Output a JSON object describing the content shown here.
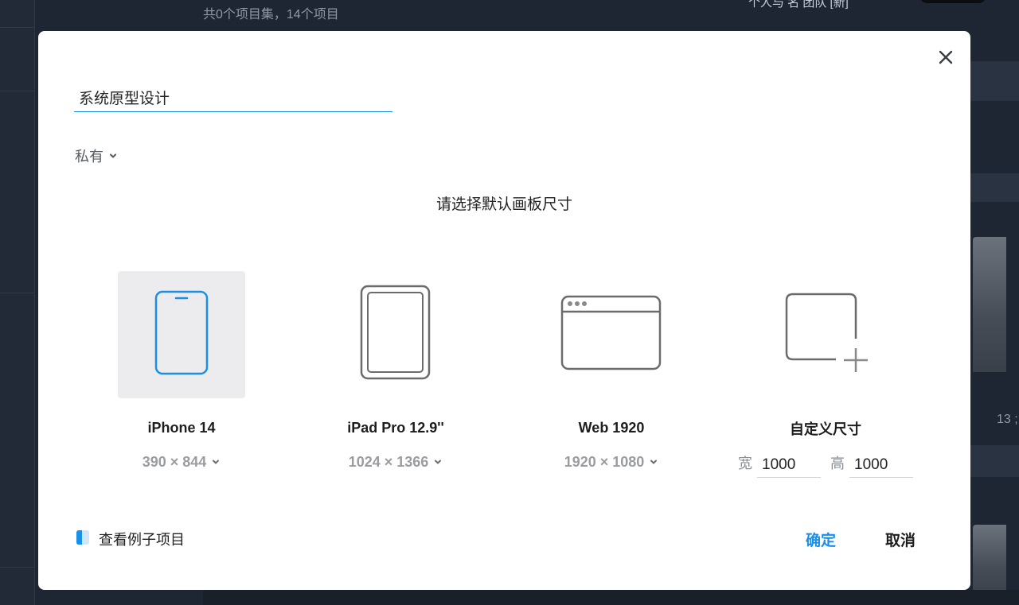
{
  "background": {
    "project_summary": "共0个项目集，14个项目",
    "header_text": "个人与 名 团队 [新]",
    "side_count": "13 ;"
  },
  "dialog": {
    "project_name": "系统原型设计",
    "visibility": "私有",
    "size_prompt": "请选择默认画板尺寸",
    "options": [
      {
        "label": "iPhone 14",
        "dims": "390 × 844",
        "icon": "phone-icon",
        "selected": true
      },
      {
        "label": "iPad Pro 12.9''",
        "dims": "1024 × 1366",
        "icon": "tablet-icon",
        "selected": false
      },
      {
        "label": "Web 1920",
        "dims": "1920 × 1080",
        "icon": "browser-window-icon",
        "selected": false
      },
      {
        "label": "自定义尺寸",
        "icon": "custom-size-icon",
        "selected": false
      }
    ],
    "custom": {
      "width_label": "宽",
      "width_value": "1000",
      "height_label": "高",
      "height_value": "1000"
    },
    "example_link": "查看例子项目",
    "confirm": "确定",
    "cancel": "取消"
  },
  "colors": {
    "accent": "#1a8fe8",
    "selected_bg": "#ececee",
    "icon_gray": "#6b6b6b",
    "backdrop": "#1f2633"
  }
}
